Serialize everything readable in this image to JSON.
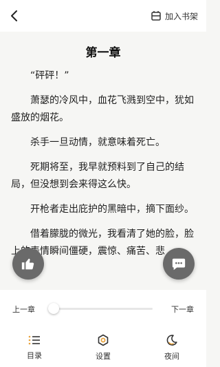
{
  "header": {
    "add_shelf_label": "加入书架"
  },
  "reader": {
    "chapter_title": "第一章",
    "paragraphs": [
      "“砰砰！”",
      "萧瑟的冷风中，血花飞溅到空中，犹如盛放的烟花。",
      "杀手一旦动情，就意味着死亡。",
      "死期将至，我早就预料到了自己的结局，但没想到会来得这么快。",
      "开枪者走出庇护的黑暗中，摘下面纱。",
      "借着朦胧的微光，我看清了她的脸，脸上的表情瞬间僵硬，震惊、痛苦、悲"
    ]
  },
  "chapter_nav": {
    "prev_label": "上一章",
    "next_label": "下一章",
    "progress": 0
  },
  "toolbar": {
    "items": [
      {
        "label": "目录",
        "icon": "catalog-icon"
      },
      {
        "label": "设置",
        "icon": "settings-icon"
      },
      {
        "label": "夜间",
        "icon": "night-mode-icon"
      }
    ]
  },
  "colors": {
    "accent": "#e8a33d",
    "background": "#f6f6f4",
    "fab": "#6a6a6a"
  }
}
